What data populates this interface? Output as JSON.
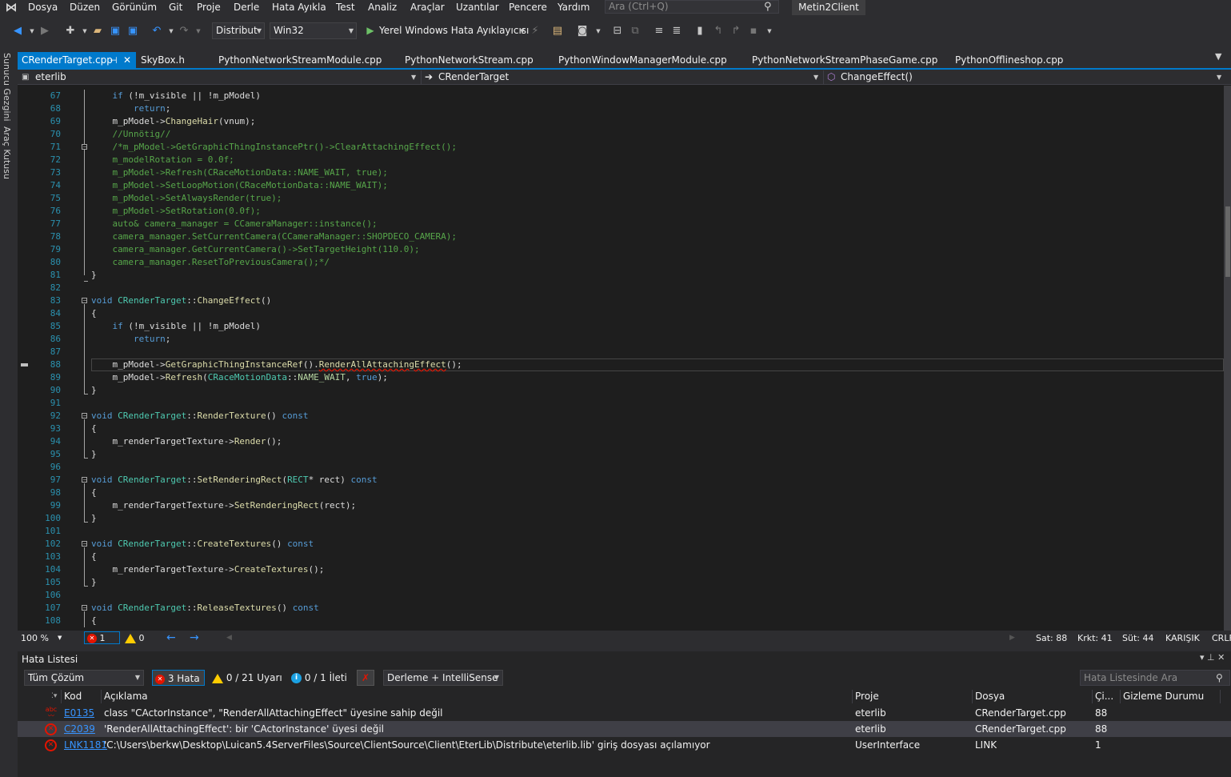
{
  "menu": {
    "items": [
      "Dosya",
      "Düzen",
      "Görünüm",
      "Git",
      "Proje",
      "Derle",
      "Hata Ayıkla",
      "Test",
      "Analiz",
      "Araçlar",
      "Uzantılar",
      "Pencere",
      "Yardım"
    ],
    "search_placeholder": "Ara (Ctrl+Q)",
    "solution_name": "Metin2Client"
  },
  "toolbar": {
    "configuration": "Distribut",
    "platform": "Win32",
    "debugger": "Yerel Windows Hata Ayıklayıcısı"
  },
  "side_panels": [
    "Sunucu Gezgini",
    "Araç Kutusu"
  ],
  "tabs": [
    {
      "label": "CRenderTarget.cpp",
      "active": true
    },
    {
      "label": "SkyBox.h"
    },
    {
      "label": "PythonNetworkStreamModule.cpp"
    },
    {
      "label": "PythonNetworkStream.cpp"
    },
    {
      "label": "PythonWindowManagerModule.cpp"
    },
    {
      "label": "PythonNetworkStreamPhaseGame.cpp"
    },
    {
      "label": "PythonOfflineshop.cpp"
    }
  ],
  "navbar": {
    "project": "eterlib",
    "scope": "CRenderTarget",
    "member": "ChangeEffect()"
  },
  "editor": {
    "line_numbers": [
      "67",
      "68",
      "69",
      "70",
      "71",
      "72",
      "73",
      "74",
      "75",
      "76",
      "77",
      "78",
      "79",
      "80",
      "81",
      "82",
      "83",
      "84",
      "85",
      "86",
      "87",
      "88",
      "89",
      "90",
      "91",
      "92",
      "93",
      "94",
      "95",
      "96",
      "97",
      "98",
      "99",
      "100",
      "101",
      "102",
      "103",
      "104",
      "105",
      "106",
      "107",
      "108"
    ],
    "current_line": "88"
  },
  "editor_status": {
    "zoom": "100 %",
    "errors": "1",
    "warnings": "0",
    "line": "Sat: 88",
    "char": "Krkt: 41",
    "col": "Süt: 44",
    "mode": "KARIŞIK",
    "eol": "CRLF"
  },
  "error_list": {
    "title": "Hata Listesi",
    "scope": "Tüm Çözüm",
    "errors_filter": "3 Hata",
    "warnings_filter": "0 / 21 Uyarı",
    "messages_filter": "0 / 1 İleti",
    "build_filter": "Derleme + IntelliSense",
    "search_placeholder": "Hata Listesinde Ara",
    "columns": {
      "code": "Kod",
      "description": "Açıklama",
      "project": "Proje",
      "file": "Dosya",
      "line": "Çi...",
      "suppression": "Gizleme Durumu"
    },
    "rows": [
      {
        "icon": "spell-error-icon",
        "code": "E0135",
        "description": "class \"CActorInstance\", \"RenderAllAttachingEffect\" üyesine sahip değil",
        "project": "eterlib",
        "file": "CRenderTarget.cpp",
        "line": "88"
      },
      {
        "icon": "error-icon",
        "code": "C2039",
        "description": "'RenderAllAttachingEffect': bir 'CActorInstance' üyesi değil",
        "project": "eterlib",
        "file": "CRenderTarget.cpp",
        "line": "88"
      },
      {
        "icon": "error-icon",
        "code": "LNK1181",
        "description": "'C:\\Users\\berkw\\Desktop\\Luican5.4ServerFiles\\Source\\ClientSource\\Client\\EterLib\\Distribute\\eterlib.lib' giriş dosyası açılamıyor",
        "project": "UserInterface",
        "file": "LINK",
        "line": "1"
      }
    ]
  },
  "colors": {
    "accent": "#007acc",
    "error": "#e51400",
    "warning": "#ffcc00",
    "keyword": "#569cd6",
    "type": "#4ec9b0",
    "comment": "#57a64a"
  }
}
